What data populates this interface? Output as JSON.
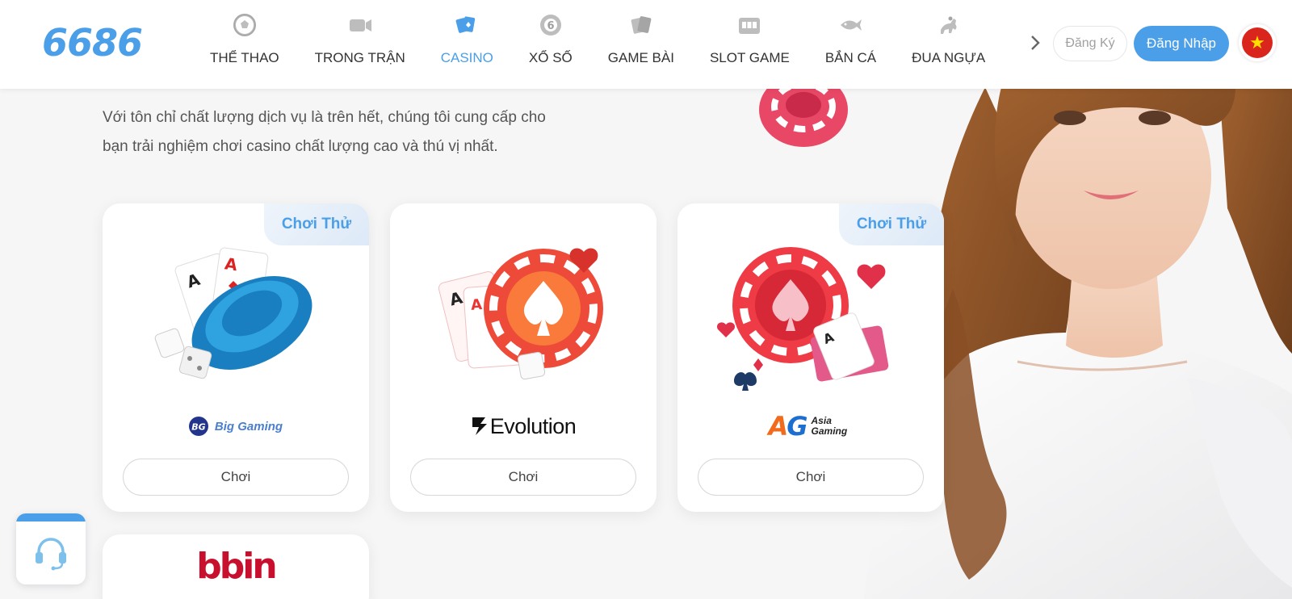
{
  "header": {
    "logo_text": "6686",
    "nav": [
      {
        "label": "THỂ THAO",
        "icon": "soccer-ball-icon",
        "active": false
      },
      {
        "label": "TRONG TRẬN",
        "icon": "video-camera-icon",
        "active": false
      },
      {
        "label": "CASINO",
        "icon": "playing-cards-icon",
        "active": true
      },
      {
        "label": "XỔ SỐ",
        "icon": "lottery-ball-icon",
        "active": false
      },
      {
        "label": "GAME BÀI",
        "icon": "card-game-icon",
        "active": false
      },
      {
        "label": "SLOT GAME",
        "icon": "slot-machine-icon",
        "active": false
      },
      {
        "label": "BẮN CÁ",
        "icon": "fish-icon",
        "active": false
      },
      {
        "label": "ĐUA NGỰA",
        "icon": "horse-racing-icon",
        "active": false
      }
    ],
    "register_label": "Đăng Ký",
    "login_label": "Đăng Nhập",
    "language_flag": "vietnam-flag-icon"
  },
  "intro": {
    "line1": "Với tôn chỉ chất lượng dịch vụ là trên hết, chúng tôi cung cấp cho",
    "line2": "bạn trải nghiệm chơi casino chất lượng cao và thú vị nhất."
  },
  "providers": [
    {
      "name": "Big Gaming",
      "logo_text": "Big Gaming",
      "badge": "Chơi Thử",
      "play_label": "Chơi"
    },
    {
      "name": "Evolution",
      "logo_text": "Evolution",
      "badge": "",
      "play_label": "Chơi"
    },
    {
      "name": "Asia Gaming",
      "logo_text": "Asia Gaming",
      "badge": "Chơi Thử",
      "play_label": "Chơi"
    },
    {
      "name": "bbin",
      "logo_text": "bbin"
    }
  ],
  "colors": {
    "accent": "#4a9fe8",
    "flag_red": "#da251d",
    "bbin_red": "#c8102e"
  }
}
